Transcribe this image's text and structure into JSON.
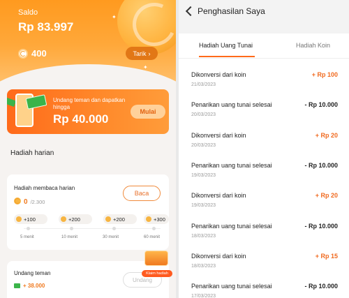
{
  "wallet": {
    "saldo_label": "Saldo",
    "saldo_value": "Rp 83.997",
    "coins": "400",
    "withdraw_label": "Tarik"
  },
  "invite_banner": {
    "text": "Undang teman dan dapatkan hingga",
    "amount": "Rp 40.000",
    "button_label": "Mulai"
  },
  "daily": {
    "section_title": "Hadiah harian",
    "reading": {
      "title": "Hadiah membaca harian",
      "progress_current": "0",
      "progress_max": "/2.300",
      "button_label": "Baca",
      "rewards": [
        {
          "amount": "+100",
          "time": "5 menit"
        },
        {
          "amount": "+200",
          "time": "10 menit"
        },
        {
          "amount": "+200",
          "time": "30 menit"
        },
        {
          "amount": "+300",
          "time": "60 menit"
        }
      ]
    },
    "invite": {
      "title": "Undang teman",
      "value": "+ 38.000",
      "button_label": "Undang"
    },
    "chest_label": "Klaim hadiah"
  },
  "earnings": {
    "page_title": "Penghasilan Saya",
    "tabs": [
      "Hadiah Uang Tunai",
      "Hadiah Koin"
    ],
    "active_tab": 0,
    "transactions": [
      {
        "title": "Dikonversi dari koin",
        "date": "21/03/2023",
        "amount": "+ Rp 100",
        "type": "plus"
      },
      {
        "title": "Penarikan uang tunai selesai",
        "date": "20/03/2023",
        "amount": "- Rp 10.000",
        "type": "minus"
      },
      {
        "title": "Dikonversi dari koin",
        "date": "20/03/2023",
        "amount": "+ Rp 20",
        "type": "plus"
      },
      {
        "title": "Penarikan uang tunai selesai",
        "date": "19/03/2023",
        "amount": "- Rp 10.000",
        "type": "minus"
      },
      {
        "title": "Dikonversi dari koin",
        "date": "19/03/2023",
        "amount": "+ Rp 20",
        "type": "plus"
      },
      {
        "title": "Penarikan uang tunai selesai",
        "date": "18/03/2023",
        "amount": "- Rp 10.000",
        "type": "minus"
      },
      {
        "title": "Dikonversi dari koin",
        "date": "18/03/2023",
        "amount": "+ Rp 15",
        "type": "plus"
      },
      {
        "title": "Penarikan uang tunai selesai",
        "date": "17/03/2023",
        "amount": "- Rp 10.000",
        "type": "minus"
      }
    ]
  },
  "colors": {
    "accent": "#ff6a1a",
    "hero_orange": "#ff9a1f",
    "plus_amount": "#f06a1f"
  }
}
